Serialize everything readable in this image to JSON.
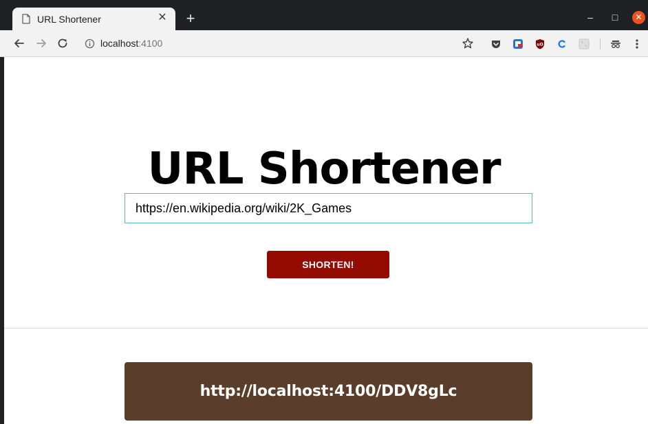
{
  "browser": {
    "tab": {
      "title": "URL Shortener",
      "close_glyph": "✕",
      "icon": "page-icon"
    },
    "new_tab_glyph": "+",
    "window_controls": {
      "minimize_glyph": "–",
      "maximize_glyph": "□",
      "close_glyph": "✕"
    },
    "address_bar": {
      "host": "localhost",
      "port": ":4100"
    },
    "extensions": [
      "pocket-icon",
      "extension-blue-icon",
      "ublock-origin-icon",
      "extension-c-icon",
      "extension-grey-icon",
      "incognito-icon"
    ],
    "colors": {
      "titlebar": "#202124",
      "toolbar": "#f2f2f2",
      "close_button": "#e95420"
    }
  },
  "page": {
    "title": "URL Shortener",
    "input": {
      "value": "https://en.wikipedia.org/wiki/2K_Games",
      "placeholder": ""
    },
    "shorten_button_label": "SHORTEN!",
    "result": {
      "short_url": "http://localhost:4100/DDV8gLc"
    },
    "colors": {
      "button": "#940b02",
      "result_box": "#5a3e2b",
      "input_border": "#5bb8d0"
    }
  }
}
